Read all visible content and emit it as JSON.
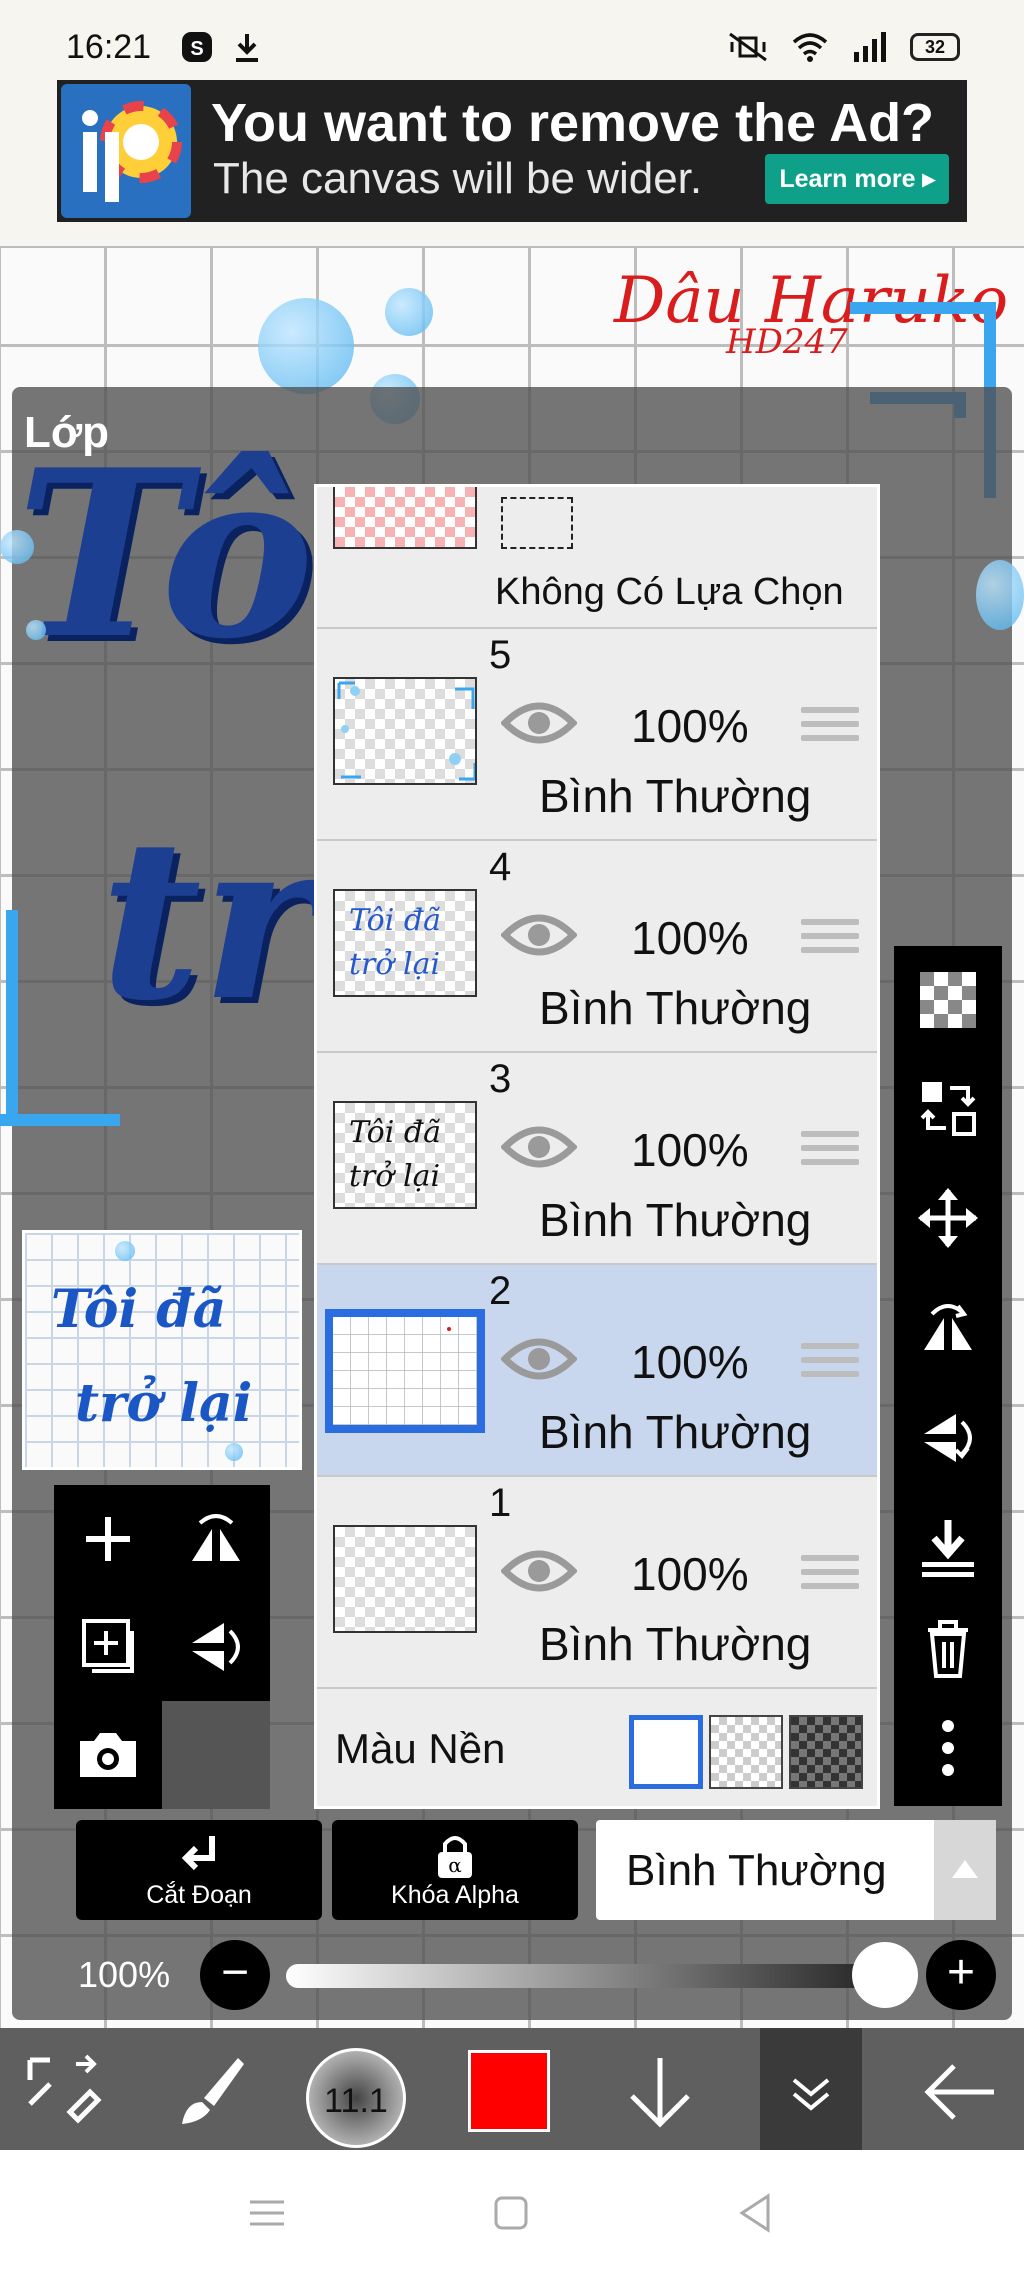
{
  "status_bar": {
    "time": "16:21",
    "battery": "32"
  },
  "ad": {
    "headline": "You want to remove the Ad?",
    "subline": "The canvas will be wider.",
    "button": "Learn more"
  },
  "canvas": {
    "signature": "Dâu Haruko",
    "signature_sub": "HD247"
  },
  "panel": {
    "title": "Lớp",
    "selection_row": {
      "label": "Không Có Lựa Chọn"
    },
    "layers": [
      {
        "number": "5",
        "opacity": "100%",
        "mode": "Bình Thường",
        "active": false
      },
      {
        "number": "4",
        "opacity": "100%",
        "mode": "Bình Thường",
        "active": false,
        "thumb_text": "Tôi đã trở lại"
      },
      {
        "number": "3",
        "opacity": "100%",
        "mode": "Bình Thường",
        "active": false,
        "thumb_text": "Tôi đã trở lại"
      },
      {
        "number": "2",
        "opacity": "100%",
        "mode": "Bình Thường",
        "active": true
      },
      {
        "number": "1",
        "opacity": "100%",
        "mode": "Bình Thường",
        "active": false
      }
    ],
    "background_row": {
      "label": "Màu Nền"
    },
    "preview_text": {
      "line1": "Tôi đã",
      "line2": "trở lại"
    },
    "clipping_label": "Cắt Đoạn",
    "alpha_lock_label": "Khóa Alpha",
    "blend_mode": "Bình Thường",
    "opacity": "100%"
  },
  "toolbar": {
    "brush_size": "11.1",
    "color": "#ff0000"
  },
  "colors": {
    "accent": "#2a6de0",
    "ad_button": "#0fa08a",
    "active_row": "#c9d7ee"
  },
  "icons": {
    "right_toolbar": [
      "transparency-icon",
      "swap-layer-icon",
      "move-icon",
      "flip-horizontal-icon",
      "flip-vertical-icon",
      "merge-down-icon",
      "trash-icon",
      "more-icon"
    ],
    "left_toolbar": [
      "add-layer-icon",
      "rotate-flip-icon",
      "add-copy-icon",
      "flip-icon",
      "camera-icon"
    ]
  }
}
